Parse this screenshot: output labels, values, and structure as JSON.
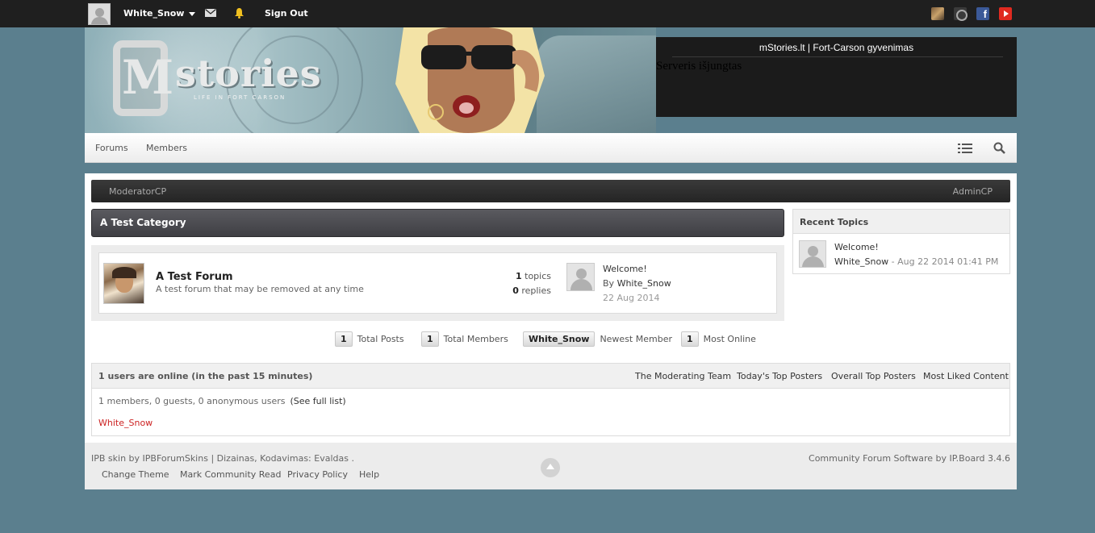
{
  "topbar": {
    "username": "White_Snow",
    "signout_label": "Sign Out",
    "social_icons": [
      "game-icon",
      "teamspeak-icon",
      "facebook-icon",
      "youtube-icon"
    ],
    "facebook_glyph": "f"
  },
  "banner": {
    "logo_text": "stories",
    "logo_letter": "M",
    "logo_tagline": "LIFE IN FORT CARSON"
  },
  "server_status": {
    "title": "mStories.lt | Fort-Carson gyvenimas",
    "message": "Serveris išjungtas"
  },
  "nav": {
    "items": [
      "Forums",
      "Members"
    ]
  },
  "modbar": {
    "left_label": "ModeratorCP",
    "right_label": "AdminCP"
  },
  "category": {
    "title": "A Test Category",
    "forum": {
      "name": "A Test Forum",
      "description": "A test forum that may be removed at any time",
      "topics_count": "1",
      "topics_label": "topics",
      "replies_count": "0",
      "replies_label": "replies",
      "last_post": {
        "title": "Welcome!",
        "by_label": "By",
        "author": "White_Snow",
        "date": "22 Aug 2014"
      }
    }
  },
  "board_stats": {
    "total_posts_value": "1",
    "total_posts_label": "Total Posts",
    "total_members_value": "1",
    "total_members_label": "Total Members",
    "newest_member_value": "White_Snow",
    "newest_member_label": "Newest Member",
    "most_online_value": "1",
    "most_online_label": "Most Online"
  },
  "recent_topics": {
    "title": "Recent Topics",
    "items": [
      {
        "title": "Welcome!",
        "author": "White_Snow",
        "date": "- Aug 22 2014 01:41 PM"
      }
    ]
  },
  "online": {
    "title": "1 users are online (in the past 15 minutes)",
    "links": [
      "The Moderating Team",
      "Today's Top Posters",
      "Overall Top Posters",
      "Most Liked Content"
    ],
    "counts": "1 members, 0 guests, 0 anonymous users",
    "full_list_label": "(See full list)",
    "users": [
      "White_Snow"
    ]
  },
  "footer": {
    "copyright": "IPB skin by IPBForumSkins | Dizainas, Kodavimas: Evaldas .",
    "links": [
      "Change Theme",
      "Mark Community Read",
      "Privacy Policy",
      "Help"
    ],
    "powered_by": "Community Forum Software by IP.Board 3.4.6"
  },
  "colors": {
    "page_bg": "#5b7f8e",
    "topbar_bg": "#1f1f1f",
    "online_user": "#cc2222"
  }
}
